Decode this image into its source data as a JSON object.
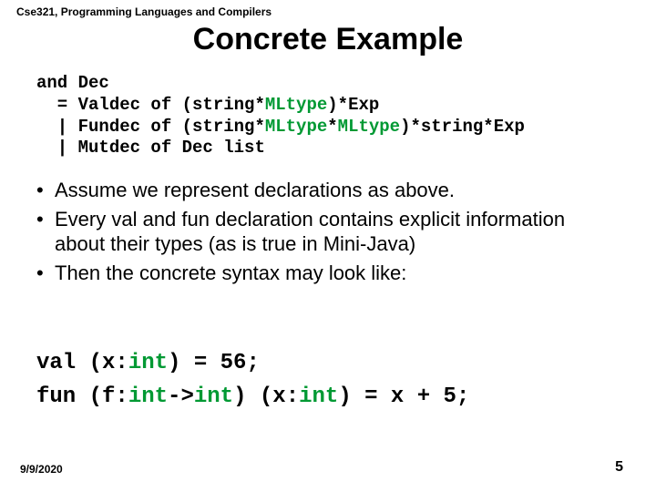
{
  "course": "Cse321, Programming Languages and Compilers",
  "title": "Concrete Example",
  "code": {
    "l1a": "and Dec",
    "l2a": "  = Valdec of (string*",
    "l2b": "MLtype",
    "l2c": ")*Exp",
    "l3a": "  | Fundec of (string*",
    "l3b": "MLtype",
    "l3c": "*",
    "l3d": "MLtype",
    "l3e": ")*string*Exp",
    "l4a": "  | Mutdec of Dec list"
  },
  "bullets": [
    "Assume we represent declarations as above.",
    "Every val and fun declaration contains explicit information about their types (as is true in Mini-Java)",
    "Then the concrete syntax may look like:"
  ],
  "example": {
    "l1a": "val (x:",
    "l1b": "int",
    "l1c": ") = 56;",
    "l2a": "fun (f:",
    "l2b": "int",
    "l2c": "->",
    "l2d": "int",
    "l2e": ") (x:",
    "l2f": "int",
    "l2g": ") = x + 5;"
  },
  "footer": {
    "date": "9/9/2020",
    "page": "5"
  }
}
